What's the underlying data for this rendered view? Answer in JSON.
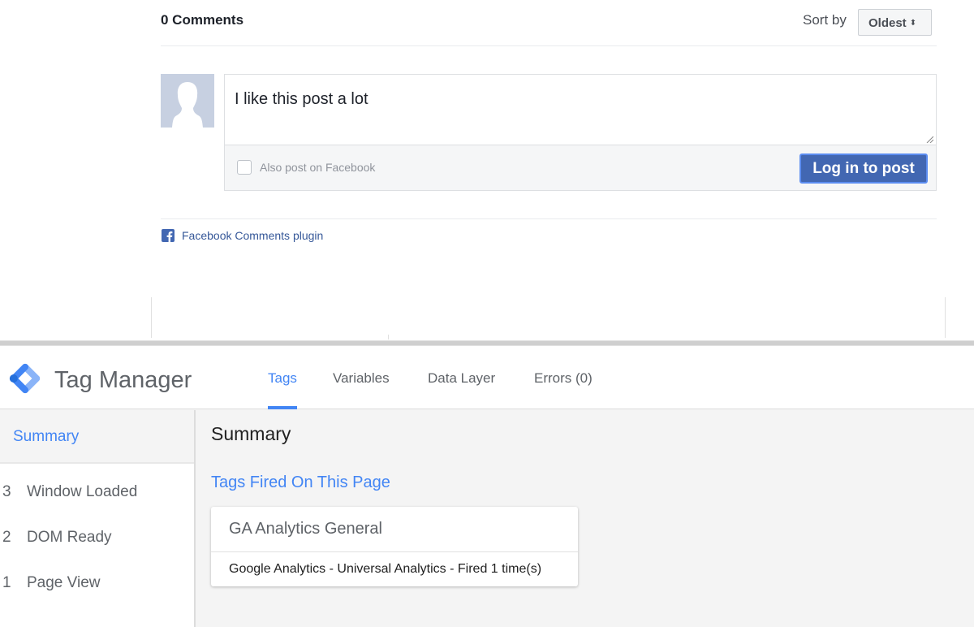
{
  "facebook_comments": {
    "count_label": "0 Comments",
    "sort": {
      "label": "Sort by",
      "selected": "Oldest",
      "arrows_glyph": "↕"
    },
    "composer": {
      "text_value": "I like this post a lot",
      "also_post_label": "Also post on Facebook",
      "also_post_checked": false,
      "submit_label": "Log in to post"
    },
    "plugin_link": "Facebook Comments plugin",
    "colors": {
      "brand": "#4267b2",
      "link": "#365899"
    }
  },
  "tag_manager": {
    "app_title": "Tag Manager",
    "tabs": [
      {
        "label": "Tags",
        "active": true
      },
      {
        "label": "Variables",
        "active": false
      },
      {
        "label": "Data Layer",
        "active": false
      },
      {
        "label": "Errors (0)",
        "active": false
      }
    ],
    "sidebar": {
      "summary_label": "Summary",
      "events": [
        {
          "number": "3",
          "label": "Window Loaded"
        },
        {
          "number": "2",
          "label": "DOM Ready"
        },
        {
          "number": "1",
          "label": "Page View"
        }
      ]
    },
    "main": {
      "title": "Summary",
      "section_title": "Tags Fired On This Page",
      "tags": [
        {
          "name": "GA Analytics General",
          "description": "Google Analytics - Universal Analytics - Fired 1 time(s)"
        }
      ]
    },
    "colors": {
      "accent": "#4285f4"
    }
  }
}
